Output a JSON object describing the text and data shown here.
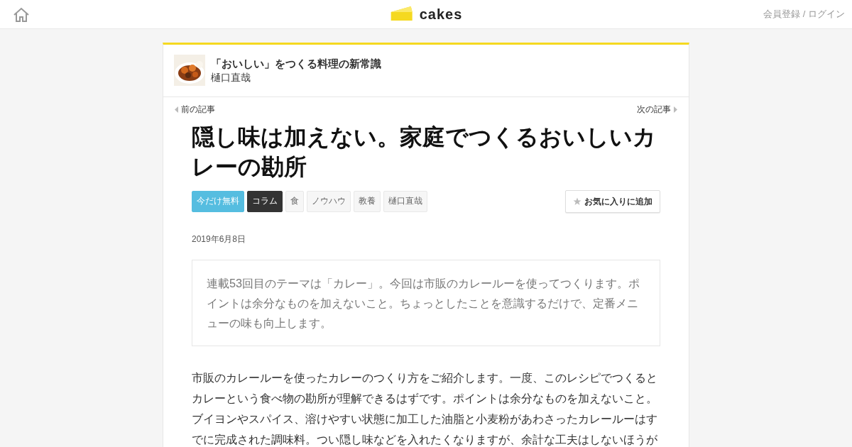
{
  "header": {
    "logo_text": "cakes",
    "account_link": "会員登録 / ログイン"
  },
  "series": {
    "title": "「おいしい」をつくる料理の新常識",
    "author": "樋口直哉"
  },
  "nav": {
    "previous": "前の記事",
    "next": "次の記事"
  },
  "article": {
    "title": "隠し味は加えない。家庭でつくるおいしいカレーの勘所",
    "tags": [
      {
        "label": "今だけ無料",
        "kind": "free"
      },
      {
        "label": "コラム",
        "kind": "category"
      },
      {
        "label": "食",
        "kind": "plain"
      },
      {
        "label": "ノウハウ",
        "kind": "plain"
      },
      {
        "label": "教養",
        "kind": "plain"
      },
      {
        "label": "樋口直哉",
        "kind": "plain"
      }
    ],
    "favorite_button": "お気に入りに追加",
    "date": "2019年6月8日",
    "lead": "連載53回目のテーマは「カレー」。今回は市販のカレールーを使ってつくります。ポイントは余分なものを加えないこと。ちょっとしたことを意識するだけで、定番メニューの味も向上します。",
    "body": "市販のカレールーを使ったカレーのつくり方をご紹介します。一度、このレシピでつくるとカレーという食べ物の勘所が理解できるはずです。ポイントは余分なものを加えないこと。ブイヨンやスパイス、溶けやすい状態に加工した油脂と小麦粉があわさったカレールーはすでに完成された調味料。つい隠し味などを入れたくなりますが、余計な工夫はしないほうが"
  }
}
